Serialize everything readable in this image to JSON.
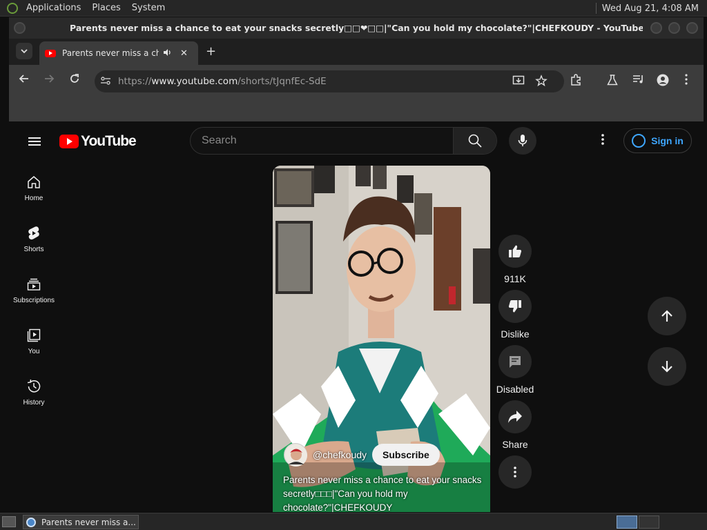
{
  "system_panel": {
    "menus": [
      "Applications",
      "Places",
      "System"
    ],
    "clock": "Wed Aug 21,  4:08 AM"
  },
  "window": {
    "title": "Parents never miss a chance to eat your snacks secretly□□❤□□|\"Can you hold my chocolate?\"|CHEFKOUDY - YouTube - Chromium"
  },
  "tab": {
    "title": "Parents never miss a chance",
    "close_glyph": "✕",
    "new_tab_glyph": "+"
  },
  "address_bar": {
    "url_prefix": "https://",
    "url_host": "www.youtube.com",
    "url_path": "/shorts/tJqnfEc-SdE"
  },
  "youtube": {
    "logo_text": "YouTube",
    "search_placeholder": "Search",
    "signin_label": "Sign in",
    "guide": [
      {
        "label": "Home"
      },
      {
        "label": "Shorts"
      },
      {
        "label": "Subscriptions"
      },
      {
        "label": "You"
      },
      {
        "label": "History"
      }
    ],
    "short": {
      "channel_handle": "@chefkoudy",
      "subscribe_label": "Subscribe",
      "caption": "Parents never miss a chance to eat your snacks secretly□□□|\"Can you hold my chocolate?\"|CHEFKOUDY"
    },
    "actions": {
      "like_count": "911K",
      "dislike_label": "Dislike",
      "comments_label": "Disabled",
      "share_label": "Share"
    }
  },
  "taskbar": {
    "window_item": "Parents never miss a..."
  },
  "colors": {
    "youtube_red": "#ff0000",
    "link_blue": "#3ea6ff",
    "page_bg": "#0f0f0f",
    "sweater_green": "#1faa59"
  }
}
